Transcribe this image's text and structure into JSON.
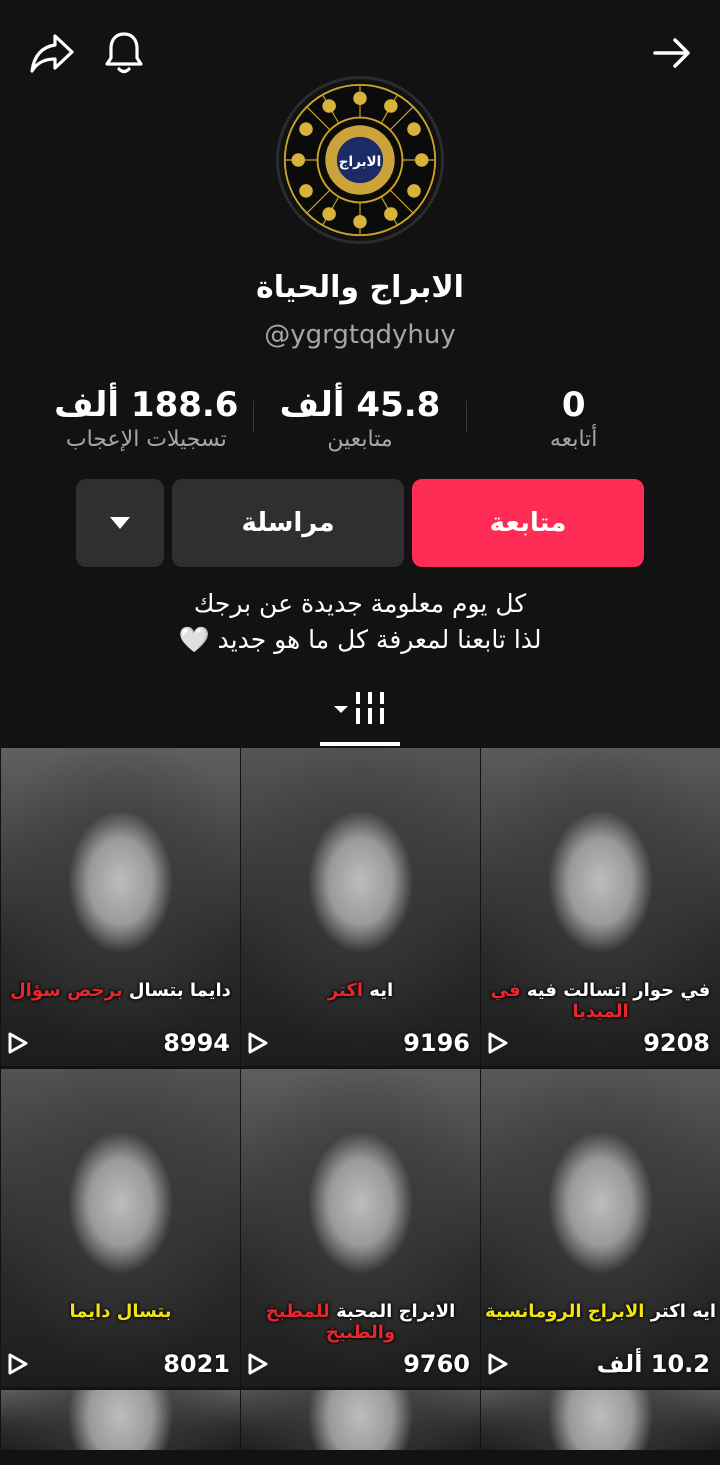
{
  "header": {
    "share_icon": "share-arrow-icon",
    "bell_icon": "bell-icon",
    "back_icon": "arrow-right-icon"
  },
  "profile": {
    "avatar_label": "الابراج",
    "name": "الابراج والحياة",
    "handle": "@ygrgtqdyhuy"
  },
  "stats": [
    {
      "value": "0",
      "label": "أتابعه"
    },
    {
      "value": "45.8 ألف",
      "label": "متابعين"
    },
    {
      "value": "188.6 ألف",
      "label": "تسجيلات الإعجاب"
    }
  ],
  "actions": {
    "follow_label": "متابعة",
    "message_label": "مراسلة",
    "more_icon": "caret-down-icon"
  },
  "bio": {
    "line1": "كل يوم معلومة جديدة عن برجك",
    "line2": "لذا تابعنا لمعرفة كل ما هو جديد 🤍"
  },
  "tabs": {
    "grid_icon": "grid-bars-icon"
  },
  "videos": [
    {
      "caption_white": "في حوار اتسالت فيه ",
      "caption_accent": "في الميديا",
      "accent_color": "#e8262e",
      "views": "9208"
    },
    {
      "caption_white": "ايه ",
      "caption_accent": "اكتر",
      "accent_color": "#e8262e",
      "views": "9196"
    },
    {
      "caption_white": "دايما بتسال ",
      "caption_accent": "برخص سؤال",
      "accent_color": "#e8262e",
      "views": "8994"
    },
    {
      "caption_white": "ايه اكتر ",
      "caption_accent": "الابراج الرومانسية",
      "accent_color": "#f2e21a",
      "views": "10.2 ألف"
    },
    {
      "caption_white": "الابراج المحبة ",
      "caption_accent": "للمطبخ والطبيخ",
      "accent_color": "#e8262e",
      "views": "9760"
    },
    {
      "caption_white": "",
      "caption_accent": "بتسال دايما",
      "accent_color": "#f2e21a",
      "views": "8021"
    }
  ]
}
